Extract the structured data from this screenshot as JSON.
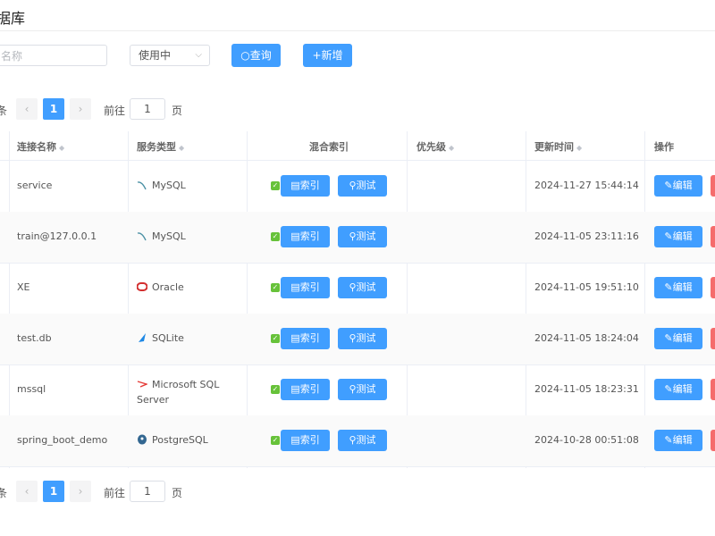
{
  "page": {
    "title": "据库"
  },
  "filters": {
    "search_placeholder": "名称",
    "status_value": "使用中",
    "query_label": "查询",
    "add_label": "新增"
  },
  "pager": {
    "total_suffix": "条",
    "prev": "‹",
    "current": "1",
    "next": "›",
    "goto_label": "前往",
    "jump_value": "1",
    "page_label": "页"
  },
  "table": {
    "columns": [
      "连接名称",
      "服务类型",
      "混合索引",
      "优先级",
      "更新时间",
      "操作"
    ],
    "index_label": "索引",
    "test_label": "测试",
    "edit_label": "编辑",
    "rows": [
      {
        "name": "service",
        "service": "MySQL",
        "time": "2024-11-27 15:44:14"
      },
      {
        "name": "train@127.0.0.1",
        "service": "MySQL",
        "time": "2024-11-05 23:11:16"
      },
      {
        "name": "XE",
        "service": "Oracle",
        "time": "2024-11-05 19:51:10"
      },
      {
        "name": "test.db",
        "service": "SQLite",
        "time": "2024-11-05 18:24:04"
      },
      {
        "name": "mssql",
        "service": "Microsoft SQL Server",
        "service_line1": "Microsoft SQL",
        "service_line2": "Server",
        "time": "2024-11-05 18:23:31"
      },
      {
        "name": "spring_boot_demo",
        "service": "PostgreSQL",
        "time": "2024-10-28 00:51:08"
      }
    ]
  },
  "colors": {
    "primary": "#409eff",
    "danger": "#f56c6c",
    "success": "#67c23a"
  },
  "icons": {
    "search": "search-icon",
    "plus": "plus-icon",
    "index": "document-icon",
    "test": "wrench-icon",
    "edit": "edit-icon"
  }
}
